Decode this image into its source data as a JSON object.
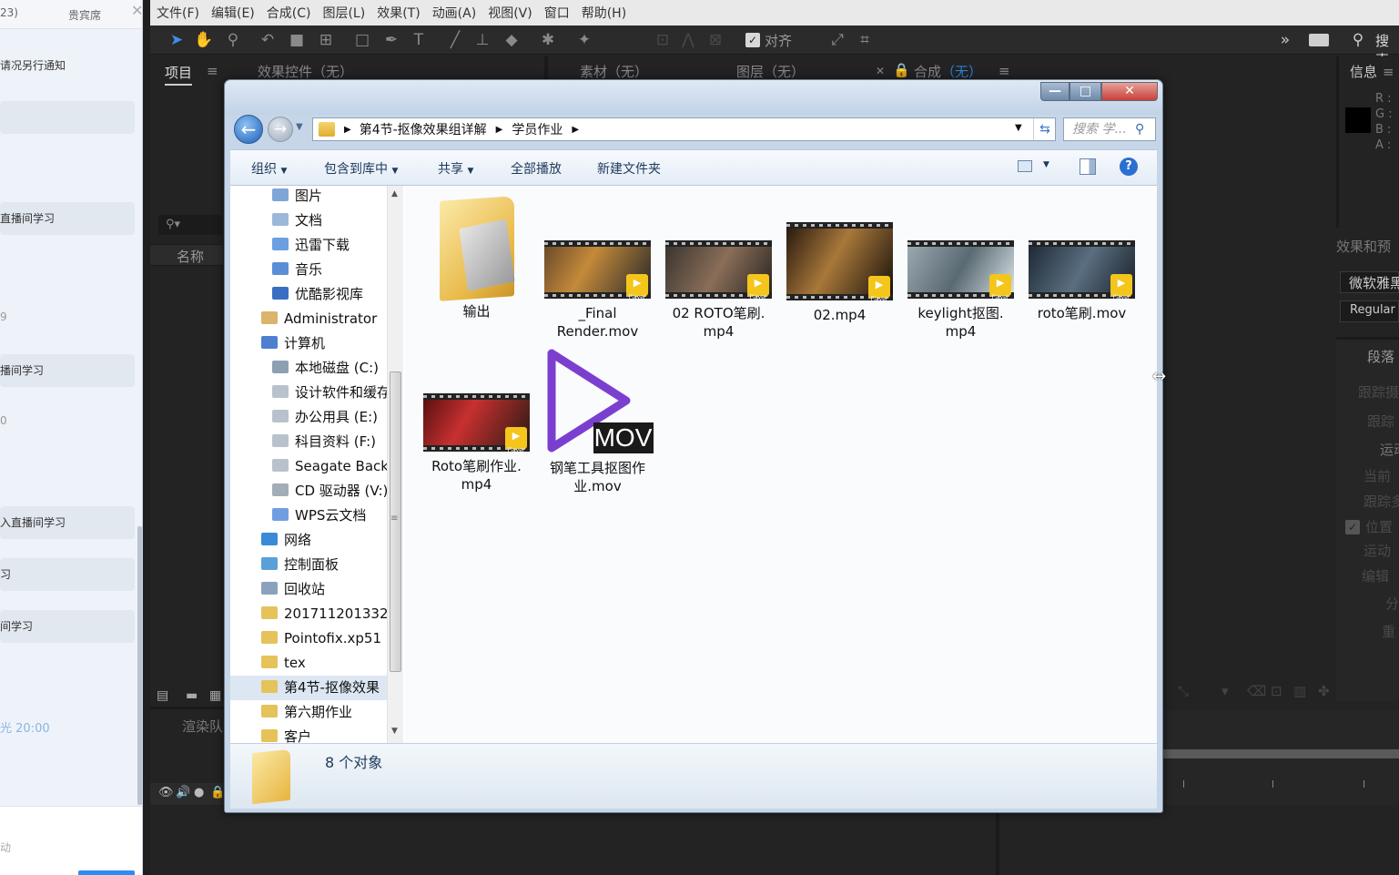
{
  "chat_panel": {
    "header_left": "23)",
    "header_right": "贵宾席",
    "rows": [
      "请况另行通知",
      "直播间学习",
      "播间学习",
      "入直播间学习",
      "习",
      "间学习"
    ],
    "num1": "9",
    "num2": "0",
    "time": "20:00",
    "bottom_text": "动"
  },
  "ae": {
    "menu": [
      "文件(F)",
      "编辑(E)",
      "合成(C)",
      "图层(L)",
      "效果(T)",
      "动画(A)",
      "视图(V)",
      "窗口",
      "帮助(H)"
    ],
    "toolbar_align_label": "对齐",
    "search_label": "搜索",
    "tabs": {
      "project": "项目",
      "effects_controls": "效果控件（无）",
      "footage": "素材（无）",
      "layer": "图层（无）",
      "composition": "合成",
      "composition_none": "（无）"
    },
    "project_column_name": "名称",
    "render_queue": "渲染队",
    "info_panel": {
      "title": "信息",
      "channels": [
        "R :",
        "G :",
        "B :",
        "A :"
      ]
    },
    "effects_panel_title": "效果和预",
    "font_name": "微软雅黑",
    "font_style": "Regular",
    "paragraph_title": "段落",
    "tracker_items": [
      "跟踪摄",
      "跟踪",
      "运动",
      "当前",
      "跟踪多",
      "位置",
      "运动",
      "编辑",
      "分",
      "重"
    ]
  },
  "explorer": {
    "window_buttons": [
      "—",
      "□",
      "✕"
    ],
    "breadcrumb": [
      "第4节-抠像效果组详解",
      "学员作业"
    ],
    "search_placeholder": "搜索 学...",
    "commands": [
      "组织",
      "包含到库中",
      "共享",
      "全部播放",
      "新建文件夹"
    ],
    "nav_items": [
      {
        "label": "图片",
        "indent": 2
      },
      {
        "label": "文档",
        "indent": 2
      },
      {
        "label": "迅雷下载",
        "indent": 2
      },
      {
        "label": "音乐",
        "indent": 2
      },
      {
        "label": "优酷影视库",
        "indent": 2
      },
      {
        "label": "Administrator",
        "indent": 1
      },
      {
        "label": "计算机",
        "indent": 1
      },
      {
        "label": "本地磁盘 (C:)",
        "indent": 2
      },
      {
        "label": "设计软件和缓存",
        "indent": 2
      },
      {
        "label": "办公用具 (E:)",
        "indent": 2
      },
      {
        "label": "科目资料 (F:)",
        "indent": 2
      },
      {
        "label": "Seagate Backu",
        "indent": 2
      },
      {
        "label": "CD 驱动器 (V:)",
        "indent": 2
      },
      {
        "label": "WPS云文档",
        "indent": 2
      },
      {
        "label": "网络",
        "indent": 1
      },
      {
        "label": "控制面板",
        "indent": 1
      },
      {
        "label": "回收站",
        "indent": 1
      },
      {
        "label": "201711201332",
        "indent": 1
      },
      {
        "label": "Pointofix.xp51",
        "indent": 1
      },
      {
        "label": "tex",
        "indent": 1
      },
      {
        "label": "第4节-抠像效果",
        "indent": 1
      },
      {
        "label": "第六期作业",
        "indent": 1
      },
      {
        "label": "客户",
        "indent": 1
      }
    ],
    "files": [
      {
        "name": "输出",
        "kind": "folder"
      },
      {
        "name": "_Final Render.mov",
        "kind": "video",
        "line1": "_Final",
        "line2": "Render.mov"
      },
      {
        "name": "02  ROTO笔刷.mp4",
        "kind": "video",
        "line1": "02  ROTO笔刷.",
        "line2": "mp4"
      },
      {
        "name": "02.mp4",
        "kind": "video",
        "line1": "02.mp4",
        "line2": ""
      },
      {
        "name": "keylight抠图.mp4",
        "kind": "video",
        "line1": "keylight抠图.",
        "line2": "mp4"
      },
      {
        "name": "roto笔刷.mov",
        "kind": "video",
        "line1": "roto笔刷.mov",
        "line2": ""
      },
      {
        "name": "Roto笔刷作业.mp4",
        "kind": "video",
        "line1": "Roto笔刷作业.",
        "line2": "mp4"
      },
      {
        "name": "钢笔工具抠图作业.mov",
        "kind": "mov",
        "line1": "钢笔工具抠图作",
        "line2": "业.mov"
      }
    ],
    "badge_text": "Player",
    "mov_label": "MOV",
    "status_count": "8 个对象"
  },
  "colors": {
    "ae_bg": "#232323",
    "explorer_frame": "#c6d6e8",
    "close_button": "#c8403a",
    "mov_purple": "#7b3fd0",
    "badge_yellow": "#f4c51b",
    "comp_accent": "#2f7fd6"
  }
}
